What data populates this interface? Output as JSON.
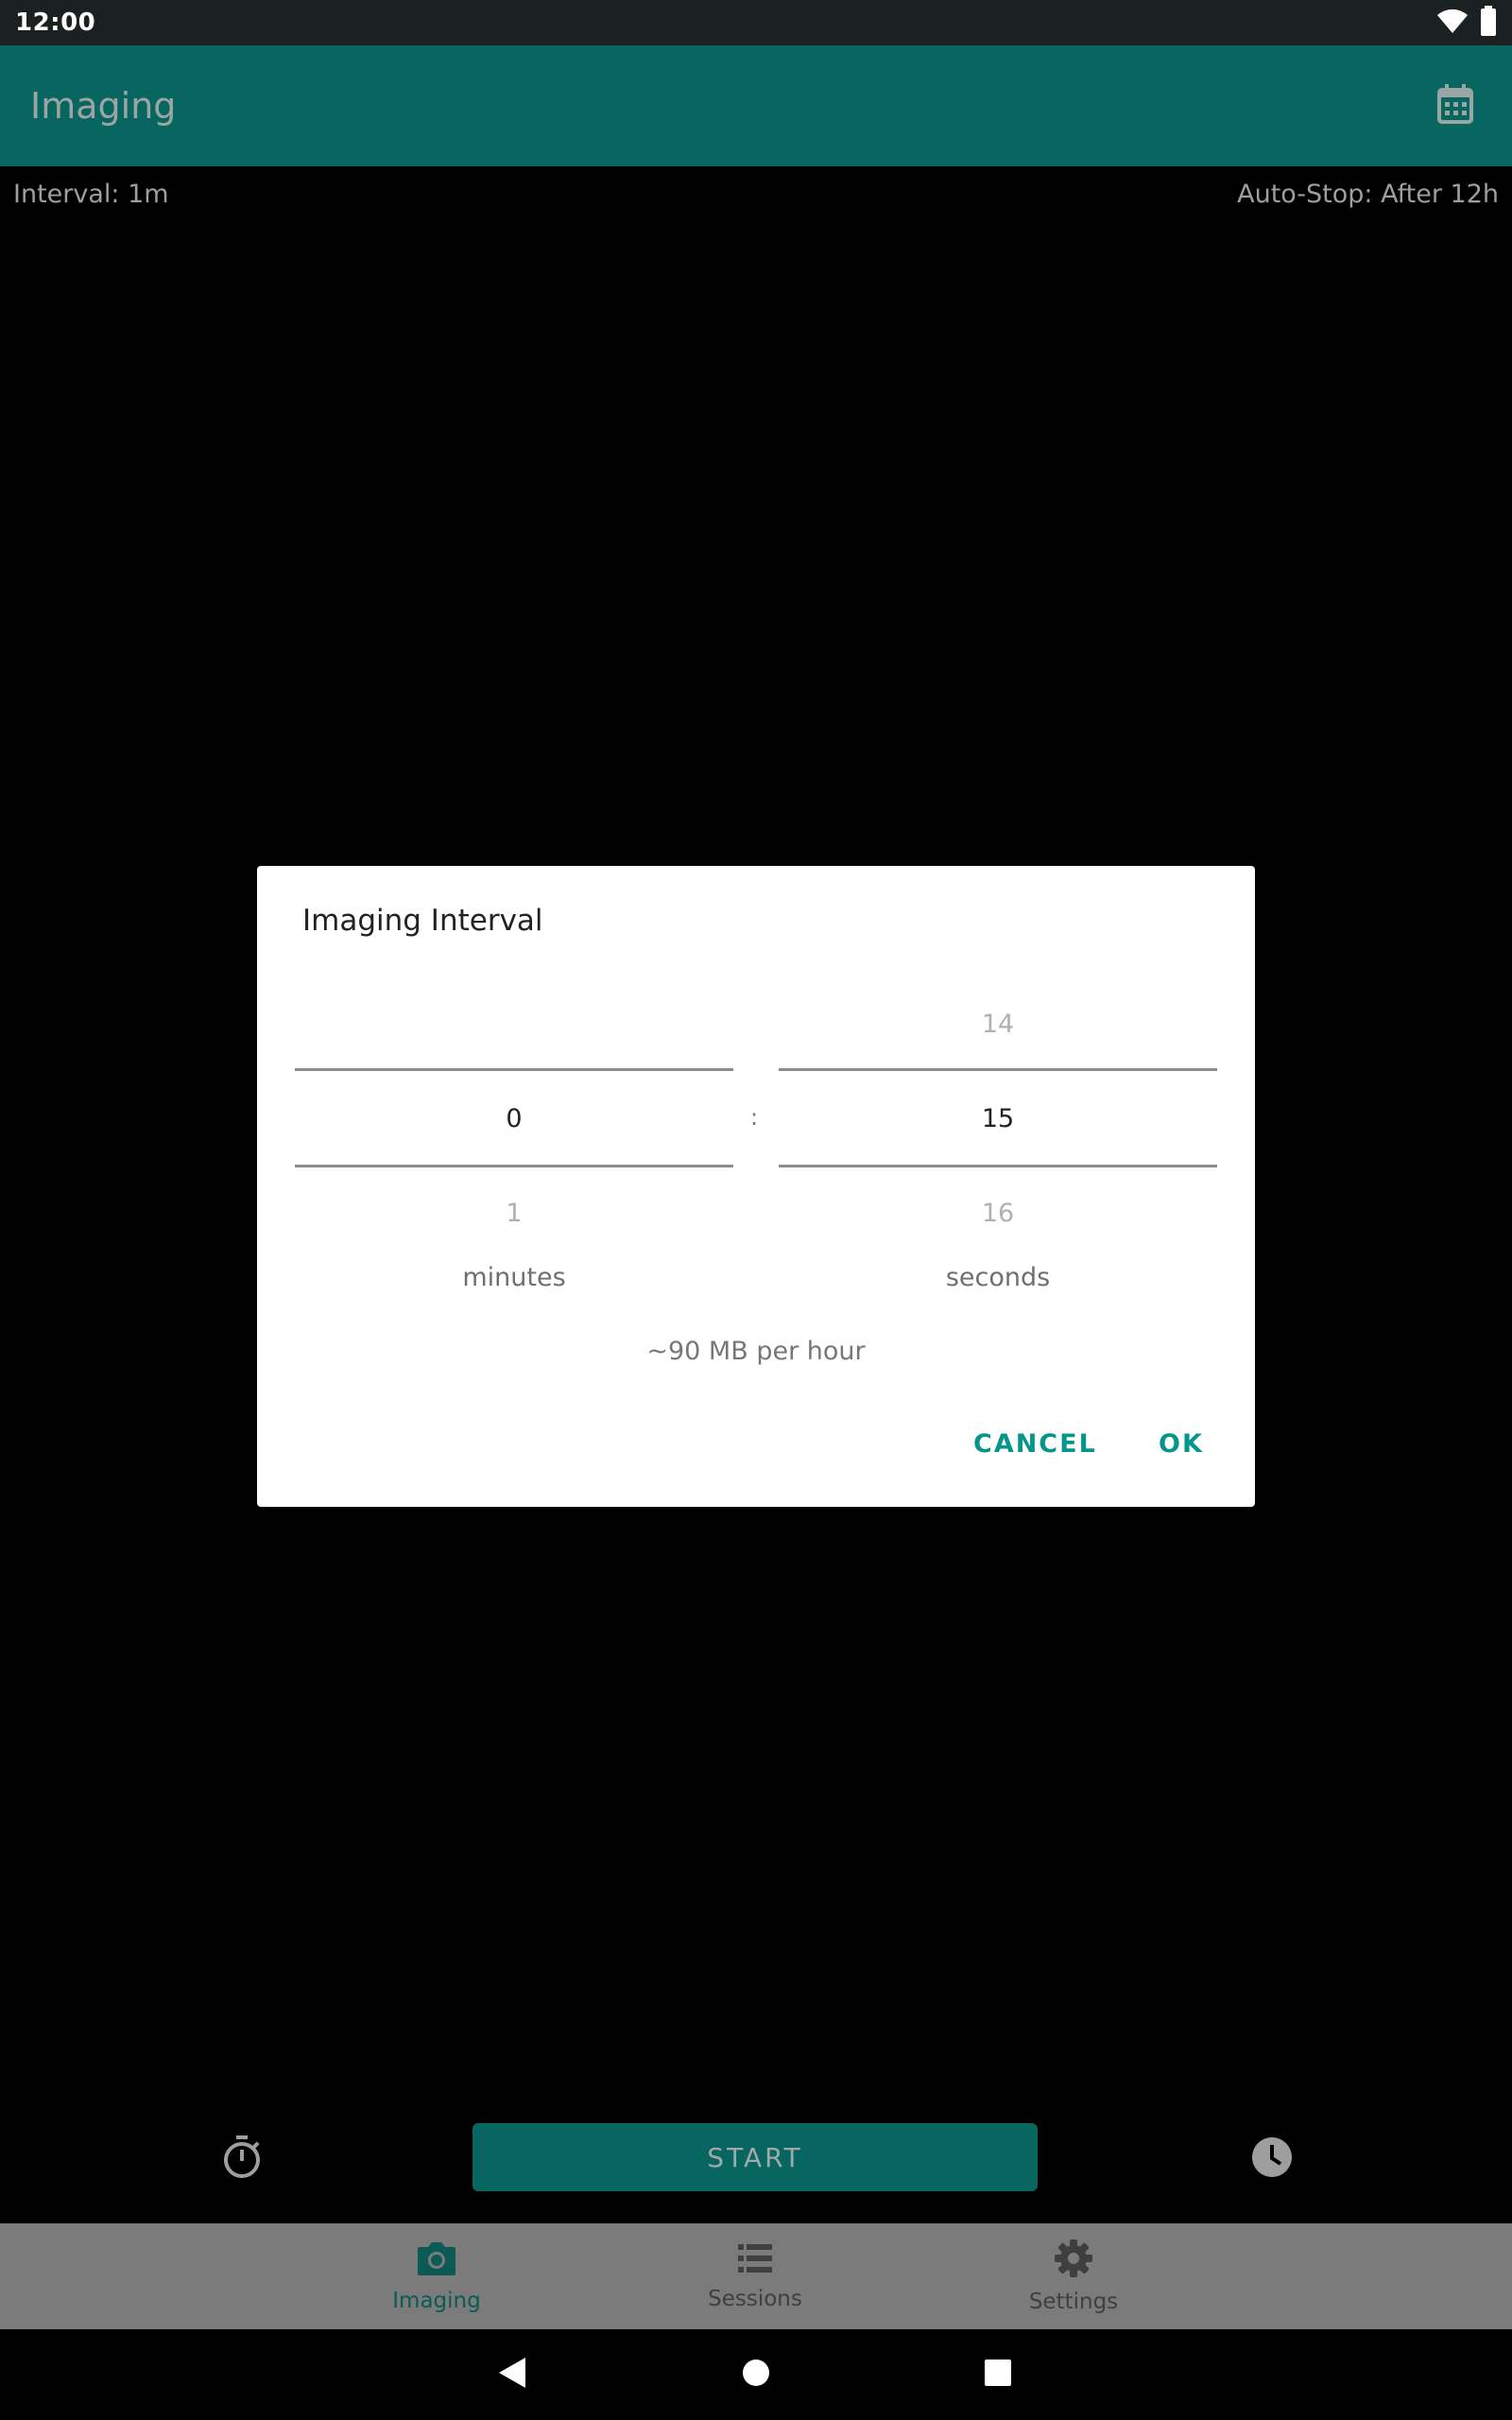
{
  "status_bar": {
    "time": "12:00",
    "icons": [
      "wifi-icon",
      "battery-icon"
    ]
  },
  "app_bar": {
    "title": "Imaging",
    "action_icon": "calendar-icon"
  },
  "info": {
    "interval": "Interval: 1m",
    "auto_stop": "Auto-Stop: After 12h"
  },
  "controls": {
    "start_label": "START",
    "left_icon": "stopwatch-icon",
    "right_icon": "clock-icon"
  },
  "bottom_nav": {
    "items": [
      {
        "label": "Imaging",
        "icon": "camera-icon",
        "active": true
      },
      {
        "label": "Sessions",
        "icon": "list-icon",
        "active": false
      },
      {
        "label": "Settings",
        "icon": "gear-icon",
        "active": false
      }
    ]
  },
  "dialog": {
    "title": "Imaging Interval",
    "minutes": {
      "prev": "",
      "current": "0",
      "next": "1",
      "unit": "minutes"
    },
    "separator": ":",
    "seconds": {
      "prev": "14",
      "current": "15",
      "next": "16",
      "unit": "seconds"
    },
    "size_note": "~90 MB per hour",
    "cancel_label": "CANCEL",
    "ok_label": "OK"
  },
  "colors": {
    "primary": "#076760",
    "accent": "#05968a",
    "dialog_bg": "#ffffff"
  }
}
